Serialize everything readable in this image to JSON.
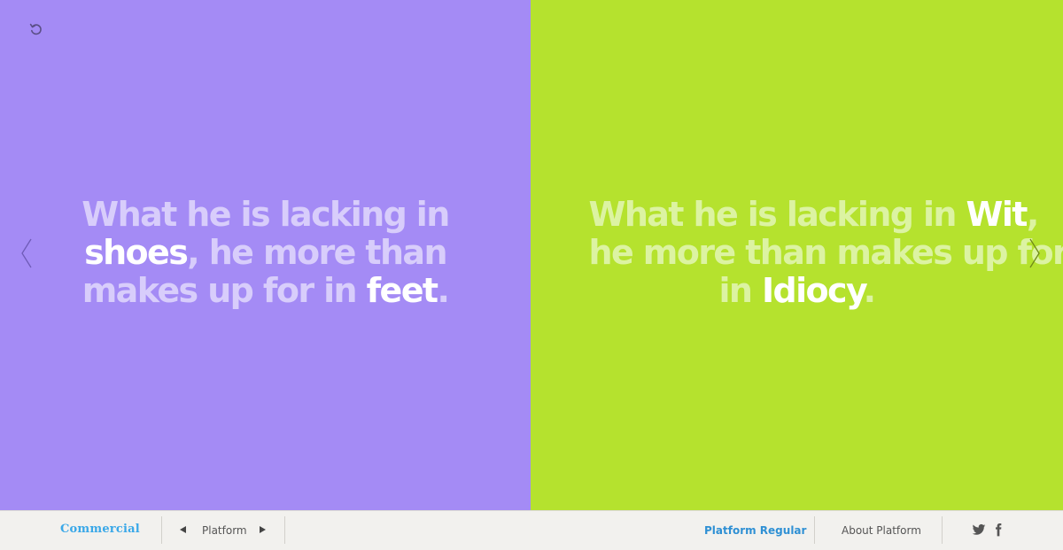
{
  "colors": {
    "left_panel_bg": "#a48bf5",
    "left_text": "#d8cdfb",
    "right_panel_bg": "#b5e22e",
    "right_text": "#dcf3a2",
    "highlight": "#ffffff",
    "brand_blue": "#3aa8e8",
    "link_blue": "#2f90d4"
  },
  "icons": {
    "reset": "reset-icon",
    "prev": "chevron-left-icon",
    "next": "chevron-right-icon",
    "twitter": "twitter-icon",
    "facebook": "facebook-icon"
  },
  "left_quote": {
    "line1": "What he is lacking in",
    "word1": "shoes",
    "line2_rest": ", he more than",
    "line3_pre": "makes up for in ",
    "word2": "feet",
    "end": "."
  },
  "right_quote": {
    "line1_pre": "What he is lacking in ",
    "word1": "Wit",
    "line1_end": ",",
    "line2": "he more than makes up for",
    "line3_pre": "in ",
    "word2": "Idiocy",
    "end": "."
  },
  "footer": {
    "brand": "Commercial",
    "family_label": "Platform",
    "font_name": "Platform Regular",
    "about": "About Platform"
  }
}
